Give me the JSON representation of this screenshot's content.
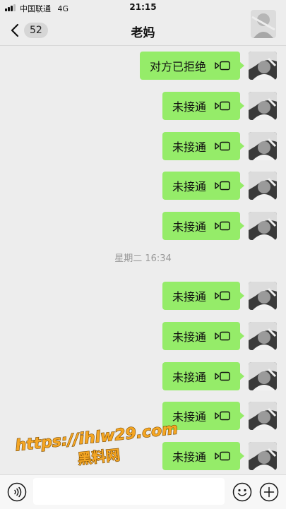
{
  "status_bar": {
    "carrier": "中国联通",
    "network": "4G",
    "time": "21:15"
  },
  "header": {
    "unread_count": "52",
    "title": "老妈"
  },
  "messages": [
    {
      "text": "对方已拒绝",
      "icon": "video-call-icon"
    },
    {
      "text": "未接通",
      "icon": "video-call-icon"
    },
    {
      "text": "未接通",
      "icon": "video-call-icon"
    },
    {
      "text": "未接通",
      "icon": "video-call-icon"
    },
    {
      "text": "未接通",
      "icon": "video-call-icon"
    },
    {
      "text": "未接通",
      "icon": "video-call-icon"
    },
    {
      "text": "未接通",
      "icon": "video-call-icon"
    },
    {
      "text": "未接通",
      "icon": "video-call-icon"
    },
    {
      "text": "未接通",
      "icon": "video-call-icon"
    },
    {
      "text": "未接通",
      "icon": "video-call-icon"
    }
  ],
  "timestamp": "星期二 16:34",
  "watermark": {
    "line1": "https://ihlw29.com",
    "line2": "黑料网"
  },
  "input_bar": {
    "value": ""
  },
  "colors": {
    "bubble": "#95ec69",
    "background": "#ededed",
    "watermark": "#f5a623"
  }
}
